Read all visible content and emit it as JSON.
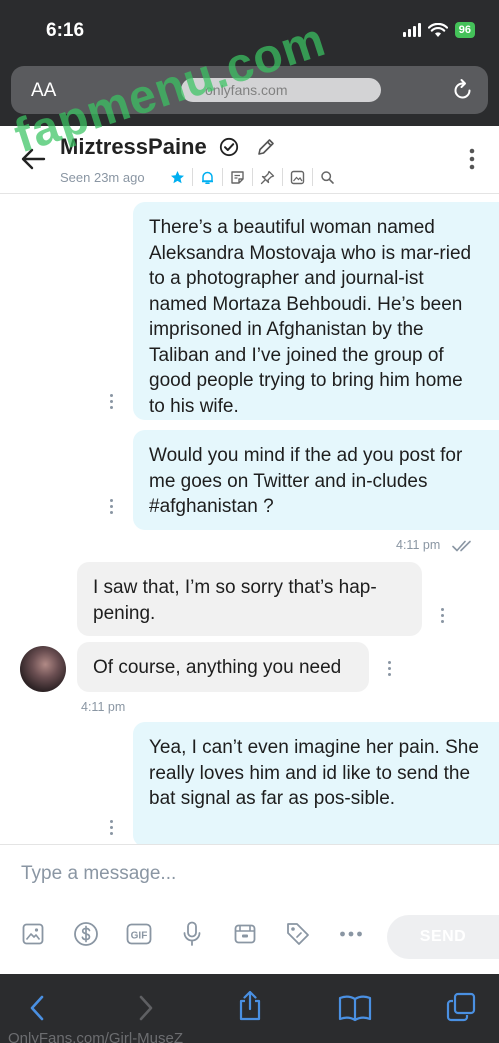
{
  "status_bar": {
    "time": "6:16",
    "battery": "96"
  },
  "browser": {
    "text_size_label": "AA",
    "url": "onlyfans.com",
    "bottom_url": "OnlyFans.com/Girl-MuseZ"
  },
  "watermark": "fapmenu.com",
  "chat": {
    "contact_name": "MiztressPaine",
    "last_seen": "Seen 23m ago",
    "header_icons": [
      "star-icon",
      "bell-icon",
      "note-icon",
      "pin-icon",
      "image-icon",
      "search-icon"
    ]
  },
  "messages": [
    {
      "direction": "out",
      "text": "There’s a beautiful woman named Aleksandra Mostovaja who is mar-ried to a photographer and journal-ist named Mortaza Behboudi. He’s been imprisoned in Afghanistan by the Taliban and I’ve joined the group of good people trying to bring him home to his wife."
    },
    {
      "direction": "out",
      "text": "Would you mind if the ad you post for me goes on Twitter and in-cludes #afghanistan ?"
    },
    {
      "direction": "in",
      "text": "I saw that, I’m so sorry that’s hap-pening."
    },
    {
      "direction": "in",
      "text": "Of course, anything you need"
    },
    {
      "direction": "out",
      "text": "Yea, I can’t even imagine her pain. She really loves him and id like to send the bat signal as far as pos-sible."
    }
  ],
  "timestamps": {
    "outgoing_1": "4:11 pm",
    "incoming_1": "4:11 pm"
  },
  "composer": {
    "placeholder": "Type a message...",
    "send_label": "SEND",
    "tools": [
      "image-icon",
      "dollar-icon",
      "gif-icon",
      "microphone-icon",
      "vault-icon",
      "price-tag-icon",
      "more-icon"
    ],
    "gif_label": "GIF"
  },
  "colors": {
    "accent": "#00aff0",
    "outgoing_bubble": "#e5f7fc",
    "incoming_bubble": "#f1f1f1",
    "muted": "#8a96a3"
  }
}
